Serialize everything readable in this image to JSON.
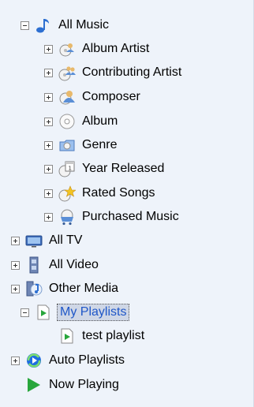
{
  "tree": {
    "all_music": "All Music",
    "album_artist": "Album Artist",
    "contributing_artist": "Contributing Artist",
    "composer": "Composer",
    "album": "Album",
    "genre": "Genre",
    "year_released": "Year Released",
    "rated_songs": "Rated Songs",
    "purchased_music": "Purchased Music",
    "all_tv": "All TV",
    "all_video": "All Video",
    "other_media": "Other Media",
    "my_playlists": "My Playlists",
    "test_playlist": "test playlist",
    "auto_playlists": "Auto Playlists",
    "now_playing": "Now Playing"
  },
  "selected": "My Playlists",
  "colors": {
    "panel_bg": "#eef3fa",
    "selection_bg": "#cfd7e6",
    "selection_text": "#1f57c8",
    "play_green": "#28a63c"
  },
  "icons": [
    "music-note-icon",
    "album-artist-icon",
    "contributing-artist-icon",
    "composer-icon",
    "album-disc-icon",
    "genre-icon",
    "calendar-icon",
    "rated-star-icon",
    "purchased-cart-icon",
    "tv-icon",
    "film-icon",
    "other-media-icon",
    "playlist-icon",
    "playlist-icon",
    "auto-playlist-icon",
    "now-playing-icon"
  ]
}
